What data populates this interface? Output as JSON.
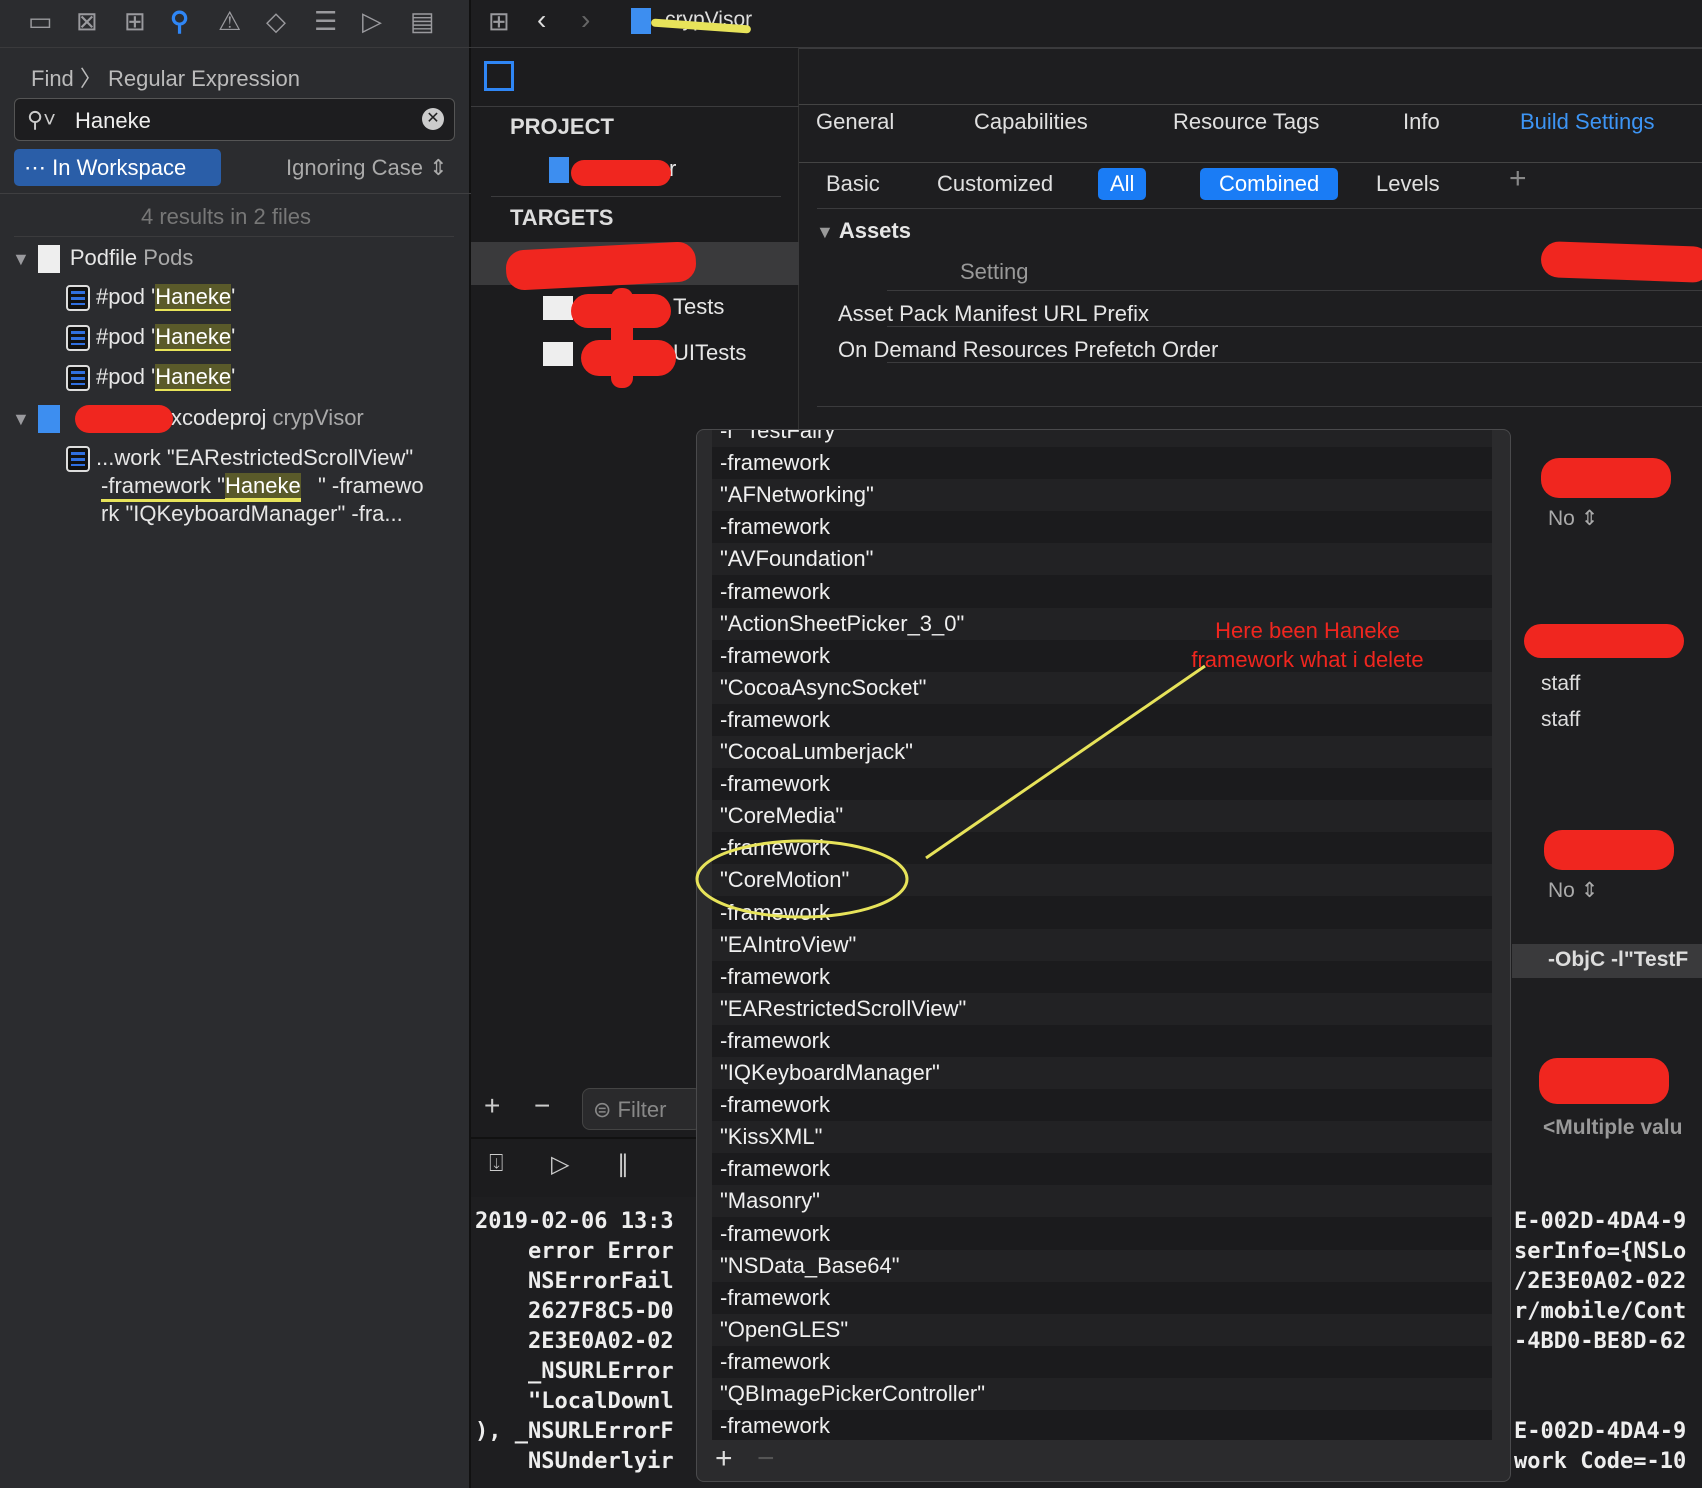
{
  "navigator_icons": [
    "folder-icon",
    "source-control-icon",
    "hierarchy-icon",
    "search-icon",
    "warning-icon",
    "test-icon",
    "debug-icon",
    "breakpoint-icon",
    "report-icon"
  ],
  "find": {
    "mode": "Find",
    "type": "Regular Expression",
    "query": "Haneke",
    "scope": "In Workspace",
    "case": "Ignoring Case",
    "summary": "4 results in 2 files"
  },
  "results": [
    {
      "file": "Podfile",
      "group": "Pods",
      "matches": [
        {
          "pre": "#pod '",
          "hit": "Haneke",
          "post": "'"
        },
        {
          "pre": "#pod '",
          "hit": "Haneke",
          "post": "'"
        },
        {
          "pre": "#pod '",
          "hit": "Haneke",
          "post": "'"
        }
      ]
    },
    {
      "file": ".xcodeproj",
      "group": "crypVisor",
      "match_lines": [
        "...work \"EARestrictedScrollView\"",
        "-framework \"",
        "Haneke",
        "\" -framewo",
        "rk \"IQKeyboardManager\" -fra..."
      ]
    }
  ],
  "toolbar": {
    "breadcrumb": "crypVisor"
  },
  "project": {
    "project_header": "PROJECT",
    "project_name_suffix": "r",
    "targets_header": "TARGETS",
    "targets": [
      "",
      "Tests",
      "UITests"
    ],
    "filter_placeholder": "Filter"
  },
  "editor": {
    "tabs": [
      "General",
      "Capabilities",
      "Resource Tags",
      "Info",
      "Build Settings"
    ],
    "active_tab": "Build Settings",
    "subtabs": [
      "Basic",
      "Customized",
      "All",
      "Combined",
      "Levels"
    ],
    "section": "Assets",
    "column": "Setting",
    "settings": [
      "Asset Pack Manifest URL Prefix",
      "On Demand Resources Prefetch Order"
    ],
    "values": [
      "No",
      "staff",
      "staff",
      "No",
      "-ObjC -l\"TestF",
      "<Multiple valu"
    ],
    "accent": "#1a7cf5"
  },
  "popover": {
    "items": [
      "-l \"TestFairy\"",
      "-framework",
      "\"AFNetworking\"",
      "-framework",
      "\"AVFoundation\"",
      "-framework",
      "\"ActionSheetPicker_3_0\"",
      "-framework",
      "\"CocoaAsyncSocket\"",
      "-framework",
      "\"CocoaLumberjack\"",
      "-framework",
      "\"CoreMedia\"",
      "-framework",
      "\"CoreMotion\"",
      "-framework",
      "\"EAIntroView\"",
      "-framework",
      "\"EARestrictedScrollView\"",
      "-framework",
      "\"IQKeyboardManager\"",
      "-framework",
      "\"KissXML\"",
      "-framework",
      "\"Masonry\"",
      "-framework",
      "\"NSData_Base64\"",
      "-framework",
      "\"OpenGLES\"",
      "-framework",
      "\"QBImagePickerController\"",
      "-framework"
    ]
  },
  "annotation": {
    "text_line1": "Here been Haneke",
    "text_line2": "framework what i delete",
    "color": "#f0261f",
    "marker_color": "#e7e35a"
  },
  "console": {
    "left": [
      "2019-02-06 13:3",
      "    error Error",
      "    NSErrorFail",
      "    2627F8C5-D0",
      "    2E3E0A02-02",
      "    _NSURLError",
      "    \"LocalDownl",
      "), _NSURLErrorF",
      "    NSUnderlyir"
    ],
    "right": [
      "E-002D-4DA4-9",
      "serInfo={NSLo",
      "/2E3E0A02-022",
      "r/mobile/Cont",
      "-4BD0-BE8D-62",
      "",
      "",
      "E-002D-4DA4-9",
      "work Code=-10"
    ]
  }
}
